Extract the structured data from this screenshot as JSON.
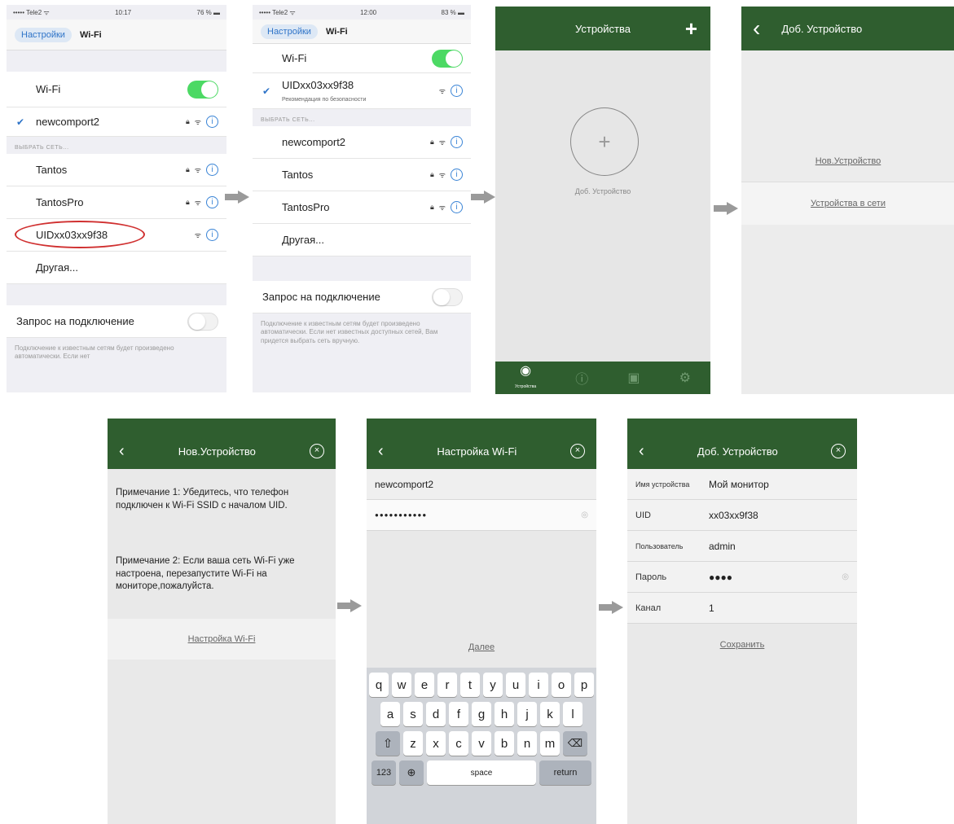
{
  "s1": {
    "status": {
      "carrier": "••••• Tele2 ᯤ",
      "time": "10:17",
      "battery": "76 % ▬"
    },
    "back": "Настройки",
    "title": "Wi-Fi",
    "wifi_label": "Wi-Fi",
    "connected": "newcomport2",
    "section": "ВЫБРАТЬ СЕТЬ...",
    "networks": [
      "Tantos",
      "TantosPro",
      "UIDxx03xx9f38"
    ],
    "other": "Другая...",
    "ask": "Запрос на подключение",
    "note": "Подключение к известным сетям будет произведено автоматически. Если нет"
  },
  "s2": {
    "status": {
      "carrier": "••••• Tele2 ᯤ",
      "time": "12:00",
      "battery": "83 % ▬"
    },
    "back": "Настройки",
    "title": "Wi-Fi",
    "wifi_label": "Wi-Fi",
    "connected": "UIDxx03xx9f38",
    "connected_sub": "Рекомендация по безопасности",
    "section": "ВЫБРАТЬ СЕТЬ...",
    "networks": [
      "newcomport2",
      "Tantos",
      "TantosPro"
    ],
    "other": "Другая...",
    "ask": "Запрос на подключение",
    "note": "Подключение к известным сетям будет произведено автоматически. Если нет известных доступных сетей, Вам придется выбрать сеть вручную."
  },
  "s3": {
    "title": "Устройства",
    "add": "+",
    "add_circle": "+",
    "add_label": "Доб. Устройство",
    "tabs": [
      "Устройства",
      "",
      "",
      ""
    ]
  },
  "s4": {
    "back": "‹",
    "title": "Доб. Устройство",
    "new": "Нов.Устройство",
    "net": "Устройства в сети"
  },
  "s5": {
    "back": "‹",
    "title": "Нов.Устройство",
    "close": "×",
    "note1": "Примечание 1: Убедитесь, что телефон подключен к Wi-Fi SSID с началом UID.",
    "note2": "Примечание 2: Если ваша сеть Wi-Fi уже настроена, перезапустите Wi-Fi на мониторе,пожалуйста.",
    "link": "Настройка Wi-Fi"
  },
  "s6": {
    "back": "‹",
    "title": "Настройка Wi-Fi",
    "close": "×",
    "ssid": "newcomport2",
    "password": "●●●●●●●●●●●",
    "eye": "◎",
    "next": "Далее",
    "row1": [
      "q",
      "w",
      "e",
      "r",
      "t",
      "y",
      "u",
      "i",
      "o",
      "p"
    ],
    "row2": [
      "a",
      "s",
      "d",
      "f",
      "g",
      "h",
      "j",
      "k",
      "l"
    ],
    "row3": [
      "z",
      "x",
      "c",
      "v",
      "b",
      "n",
      "m"
    ],
    "shift": "⇧",
    "del": "⌫",
    "num": "123",
    "globe": "⊕",
    "space": "space",
    "ret": "return"
  },
  "s7": {
    "back": "‹",
    "title": "Доб. Устройство",
    "close": "×",
    "fields": [
      {
        "label": "Имя устройства",
        "value": "Мой монитор"
      },
      {
        "label": "UID",
        "value": "xx03xx9f38"
      },
      {
        "label": "Пользователь",
        "value": "admin"
      },
      {
        "label": "Пароль",
        "value": "●●●●"
      },
      {
        "label": "Канал",
        "value": "1"
      }
    ],
    "eye": "◎",
    "save": "Сохранить"
  }
}
